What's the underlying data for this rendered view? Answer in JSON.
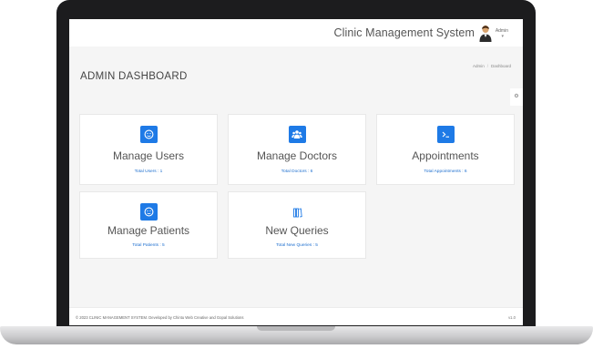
{
  "header": {
    "app_title": "Clinic Management System",
    "user_name": "Admin",
    "avatar_icon": "user-avatar-icon"
  },
  "page": {
    "title": "ADMIN DASHBOARD",
    "breadcrumb": [
      "Admin",
      "Dashboard"
    ]
  },
  "cards": [
    {
      "title": "Manage Users",
      "count_label": "Total Users : 1",
      "icon": "smiley-icon"
    },
    {
      "title": "Manage Doctors",
      "count_label": "Total Doctors : 6",
      "icon": "users-group-icon"
    },
    {
      "title": "Appointments",
      "count_label": "Total Appointments : 6",
      "icon": "terminal-icon"
    },
    {
      "title": "Manage Patients",
      "count_label": "Total Patients : 5",
      "icon": "smiley-icon"
    },
    {
      "title": "New Queries",
      "count_label": "Total New Queries : 5",
      "icon": "books-icon"
    }
  ],
  "footer": {
    "copyright": "© 2023 CLINIC MANAGEMENT SYSTEM. Developed by Chintu Web Creative and Gopal Solutions",
    "version": "v1.0"
  },
  "colors": {
    "accent": "#1e7ae6",
    "link": "#1e6fcf",
    "frame": "#1c1c1e",
    "background": "#f5f5f5"
  }
}
